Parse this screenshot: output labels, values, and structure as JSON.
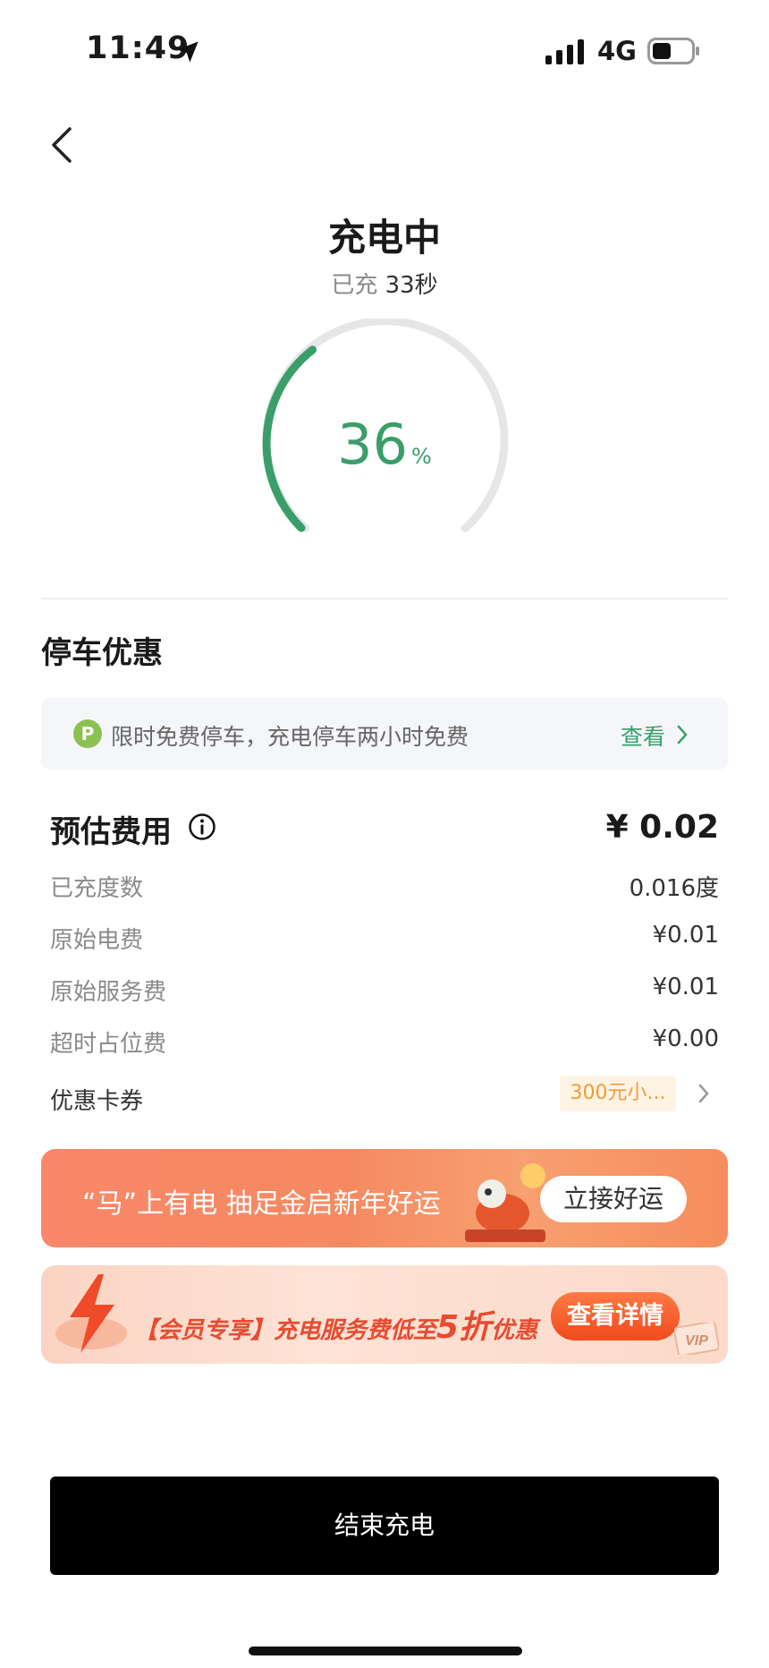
{
  "status_bar": {
    "time": "11:49",
    "network": "4G"
  },
  "header": {
    "title": "充电中",
    "elapsed_prefix": "已充",
    "elapsed_value": "33秒"
  },
  "gauge": {
    "percent": 36,
    "percent_text": "36",
    "unit": "%",
    "accent": "#3a9e6a"
  },
  "parking": {
    "section_title": "停车优惠",
    "icon_letter": "P",
    "text": "限时免费停车，充电停车两小时免费",
    "link": "查看"
  },
  "fees": {
    "title": "预估费用",
    "total": "¥ 0.02",
    "rows": [
      {
        "label": "已充度数",
        "value": "0.016度"
      },
      {
        "label": "原始电费",
        "value": "¥0.01"
      },
      {
        "label": "原始服务费",
        "value": "¥0.01"
      },
      {
        "label": "超时占位费",
        "value": "¥0.00"
      }
    ],
    "coupon_label": "优惠卡券",
    "coupon_badge": "300元小..."
  },
  "banners": {
    "banner1_text": "“马”上有电 抽足金启新年好运",
    "banner1_button": "立接好运",
    "banner2_text_a": "【会员专享】充电服务费低至",
    "banner2_text_big": "5折",
    "banner2_text_b": "优惠",
    "banner2_button": "查看详情",
    "vip_tag": "VIP"
  },
  "actions": {
    "end_button": "结束充电"
  },
  "colors": {
    "accent_green": "#3a9e6a",
    "park_icon": "#8cc152",
    "coupon_orange": "#f29b38"
  }
}
